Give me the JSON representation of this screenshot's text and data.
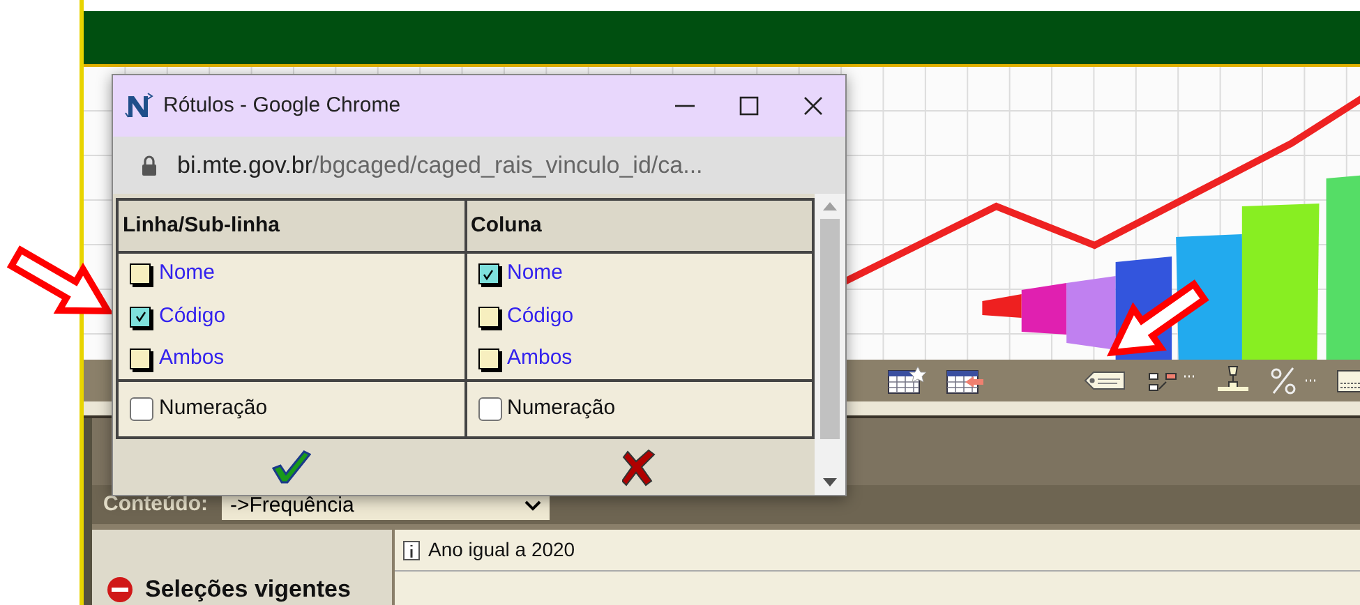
{
  "popup": {
    "title": "Rótulos - Google Chrome",
    "url_host": "bi.mte.gov.br",
    "url_path": "/bgcaged/caged_rais_vinculo_id/ca...",
    "columns": [
      {
        "heading": "Linha/Sub-linha",
        "options": [
          {
            "label": "Nome",
            "checked": false
          },
          {
            "label": "Código",
            "checked": true
          },
          {
            "label": "Ambos",
            "checked": false
          }
        ],
        "numbering": {
          "label": "Numeração",
          "checked": false
        }
      },
      {
        "heading": "Coluna",
        "options": [
          {
            "label": "Nome",
            "checked": true
          },
          {
            "label": "Código",
            "checked": false
          },
          {
            "label": "Ambos",
            "checked": false
          }
        ],
        "numbering": {
          "label": "Numeração",
          "checked": false
        }
      }
    ]
  },
  "content": {
    "label": "Conteúdo:",
    "select_value": "->Frequência"
  },
  "selections": {
    "heading": "Seleções vigentes",
    "items": [
      "Ano igual a 2020"
    ]
  }
}
